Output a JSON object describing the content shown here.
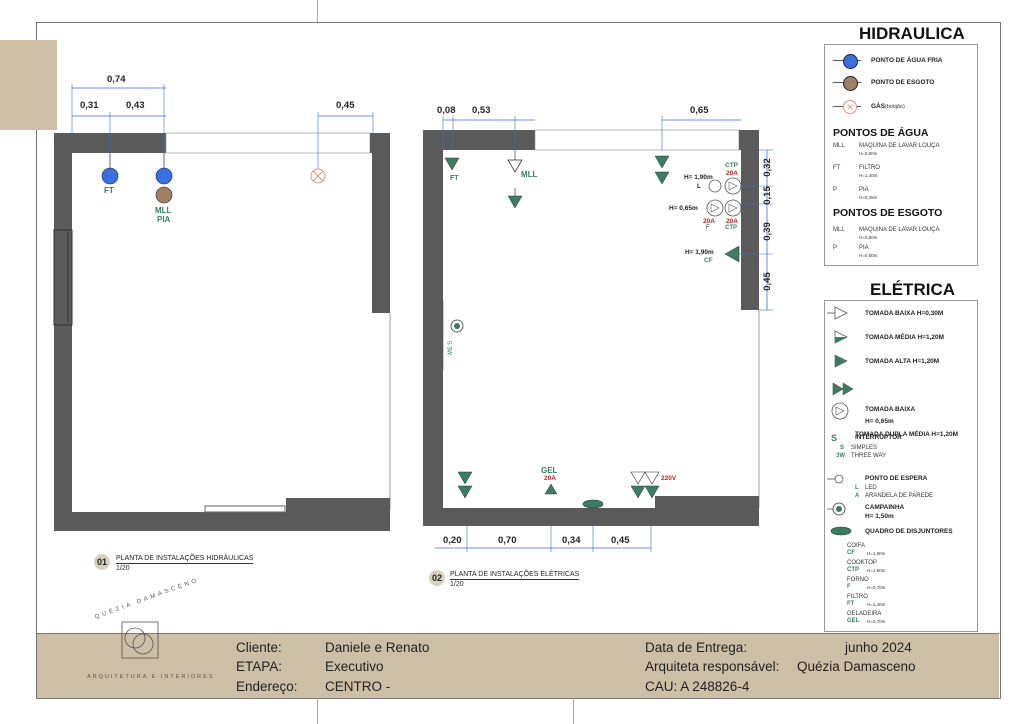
{
  "header": {
    "hidraulica_title": "HIDRAULICA",
    "eletrica_title": "ELÉTRICA"
  },
  "legend_hidraulica": {
    "items": [
      {
        "label": "PONTO DE ÁGUA FRIA",
        "color": "#3b6fe0"
      },
      {
        "label": "PONTO DE ESGOTO",
        "color": "#a08060"
      },
      {
        "label": "GÁS",
        "sub": "(botijão)",
        "color": "#e09080"
      }
    ],
    "pontos_agua_title": "PONTOS DE ÁGUA",
    "pontos_agua": [
      {
        "code": "MLL",
        "name": "MAQUINA DE LAVAR LOUÇA",
        "h": "H=0,80m"
      },
      {
        "code": "FT",
        "name": "FILTRO",
        "h": "H=1,40m"
      },
      {
        "code": "P",
        "name": "PIA",
        "h": "H=0,45m"
      }
    ],
    "pontos_esgoto_title": "PONTOS DE ESGOTO",
    "pontos_esgoto": [
      {
        "code": "MLL",
        "name": "MAQUINA DE LAVAR LOUÇA",
        "h": "H=0,50m"
      },
      {
        "code": "P",
        "name": "PIA",
        "h": "H=0,50m"
      }
    ]
  },
  "legend_eletrica": {
    "items": [
      {
        "label": "TOMADA BAIXA H=0,30M"
      },
      {
        "label": "TOMADA MÉDIA H=1,20M"
      },
      {
        "label": "TOMADA ALTA H=1,20M"
      },
      {
        "label": "TOMADA DUPLA MÉDIA H=1,20M"
      },
      {
        "label": "TOMADA BAIXA",
        "sub": "H= 0,65m"
      },
      {
        "label": "INTERRUPTOR"
      }
    ],
    "interruptor_types": [
      {
        "code": "S",
        "name": "SIMPLES"
      },
      {
        "code": "3W",
        "name": "THREE WAY"
      }
    ],
    "espera_title": "PONTO DE ESPERA",
    "espera_types": [
      {
        "code": "L",
        "name": "LED"
      },
      {
        "code": "A",
        "name": "ARANDELA DE PAREDE"
      }
    ],
    "campainha": "CAMPAINHA",
    "campainha_h": "H= 1,50m",
    "quadro": "QUADRO DE DISJUNTORES",
    "equipments": [
      {
        "name": "COIFA",
        "code": "CF",
        "h": "H=1,80m"
      },
      {
        "name": "COOKTOP",
        "code": "CTP",
        "h": "H=1,80m"
      },
      {
        "name": "FORNO",
        "code": "F",
        "h": "H=0,70m"
      },
      {
        "name": "FILTRO",
        "code": "FT",
        "h": "H=1,40m"
      },
      {
        "name": "GELADEIRA",
        "code": "GEL",
        "h": "H=0,70m"
      }
    ]
  },
  "plan1": {
    "number": "01",
    "title": "PLANTA DE INSTALAÇÕES HIDRÁULICAS",
    "scale": "1/20",
    "dims": {
      "total": "0,74",
      "a": "0,31",
      "b": "0,43",
      "gas": "0,45"
    },
    "labels": {
      "ft": "FT",
      "mll": "MLL",
      "pia": "PIA"
    }
  },
  "plan2": {
    "number": "02",
    "title": "PLANTA DE INSTALAÇÕES ELÉTRICAS",
    "scale": "1/20",
    "dims_top": [
      "0,08",
      "0,53",
      "0,65"
    ],
    "dims_right": [
      "0,32",
      "0,15",
      "0,39",
      "0,45"
    ],
    "dims_bottom": [
      "0,20",
      "0,70",
      "0,34",
      "0,45"
    ],
    "labels": {
      "ft": "FT",
      "mll": "MLL",
      "ctp": "CTP",
      "a20": "20A",
      "l": "L",
      "h190": "H= 1,90m",
      "h065": "H= 0,65m",
      "f": "F",
      "cf": "CF",
      "gel": "GEL",
      "v220": "220V",
      "sw": "S 3W"
    }
  },
  "footer": {
    "brand_top": "QUÉZIA DAMASCENO",
    "brand_bottom": "ARQUITETURA E INTERIORES",
    "cliente_label": "Cliente:",
    "cliente_value": "Daniele e Renato",
    "etapa_label": "ETAPA:",
    "etapa_value": "Executivo",
    "endereco_label": "Endereço:",
    "endereco_value": "CENTRO -",
    "data_label": "Data de Entrega:",
    "data_value": "junho 2024",
    "arquiteta_label": "Arquiteta responsável:",
    "arquiteta_value": "Quézia Damasceno",
    "cau": "CAU: A 248826-4"
  },
  "colors": {
    "wall": "#5a5a5a",
    "water": "#3b6fe0",
    "sewer": "#a08060",
    "socket": "#3b7d63",
    "accent_red": "#c0202a",
    "footer_bg": "#cdbfa6",
    "tab_bg": "#cdbfa6"
  }
}
